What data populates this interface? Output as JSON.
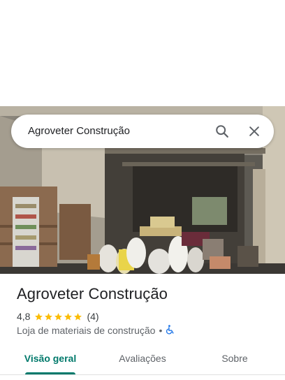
{
  "search": {
    "query": "Agroveter Construção"
  },
  "place": {
    "name": "Agroveter Construção",
    "rating": "4,8",
    "stars": 5,
    "review_count": "(4)",
    "category": "Loja de materiais de construção",
    "separator": "•"
  },
  "tabs": [
    {
      "label": "Visão geral",
      "active": true
    },
    {
      "label": "Avaliações",
      "active": false
    },
    {
      "label": "Sobre",
      "active": false
    }
  ],
  "colors": {
    "accent": "#00796b",
    "star": "#fbbc04",
    "accessibility": "#1a73e8"
  },
  "icons": {
    "search": "search-icon",
    "close": "close-icon",
    "accessibility": "wheelchair-icon"
  }
}
